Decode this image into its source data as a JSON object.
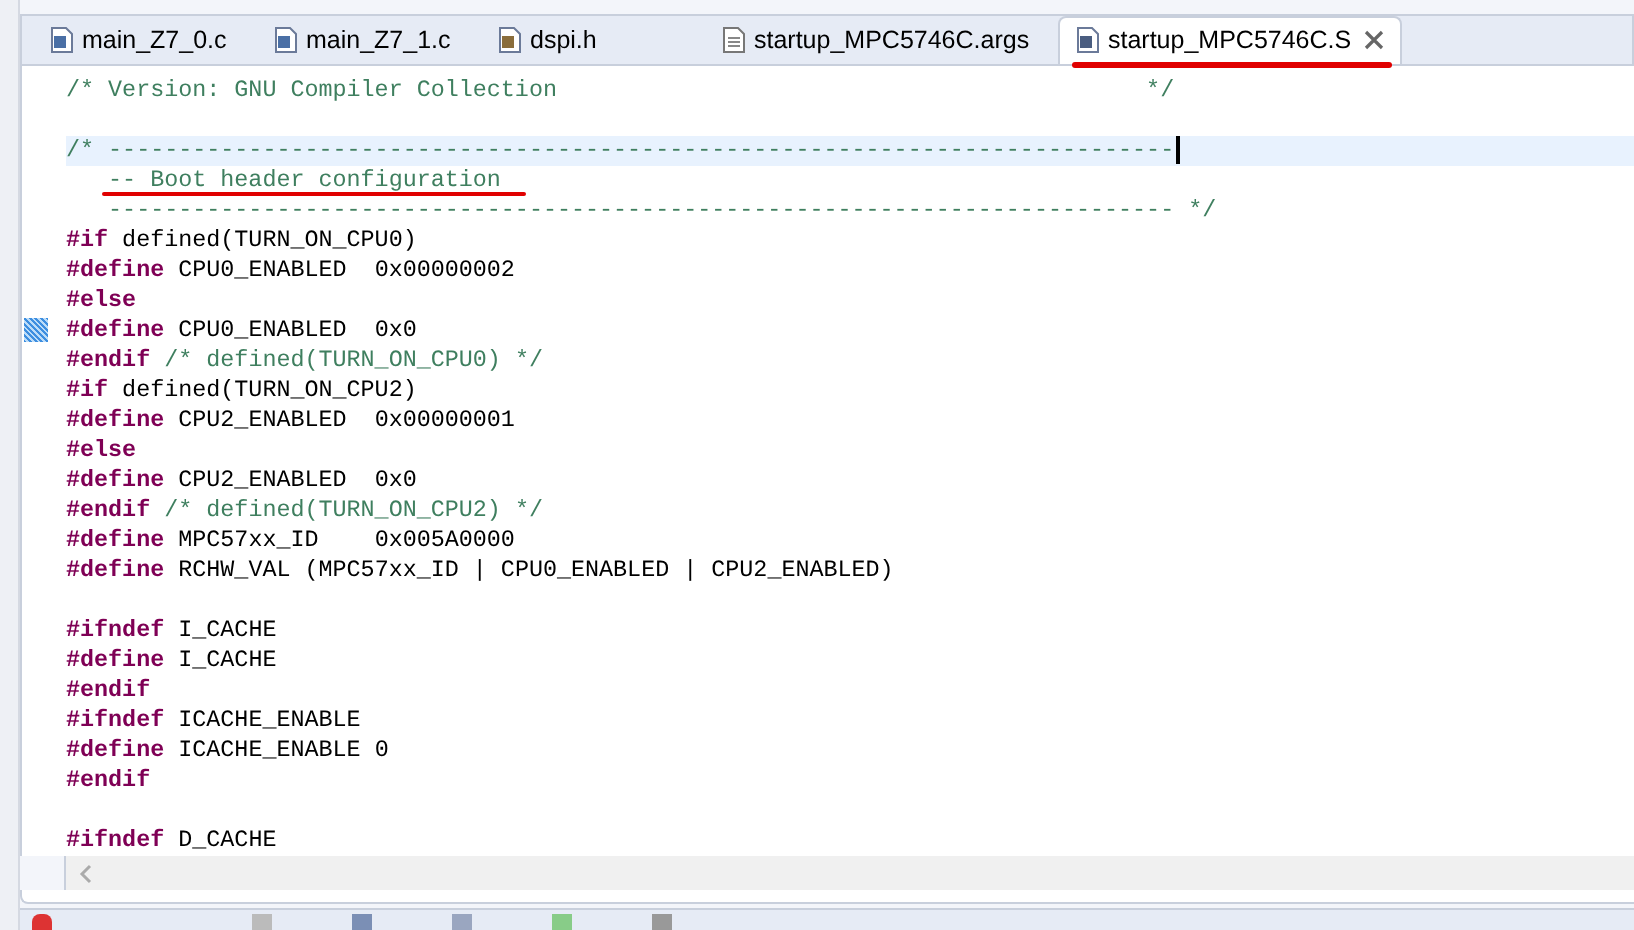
{
  "tabs": [
    {
      "label": "main_Z7_0.c",
      "kind": "c",
      "selected": false
    },
    {
      "label": "main_Z7_1.c",
      "kind": "c",
      "selected": false
    },
    {
      "label": "dspi.h",
      "kind": "h",
      "selected": false
    },
    {
      "label": "startup_MPC5746C.args",
      "kind": "text",
      "selected": false
    },
    {
      "label": "startup_MPC5746C.S",
      "kind": "asm",
      "selected": true
    }
  ],
  "lines": [
    {
      "kind": "code",
      "current": false,
      "bookmark": false,
      "tokens": [
        {
          "kind": "comment",
          "text": "/* Version: GNU Compiler Collection                                          */"
        }
      ]
    },
    {
      "kind": "blank",
      "current": false,
      "bookmark": false
    },
    {
      "kind": "code",
      "current": true,
      "bookmark": false,
      "tokens": [
        {
          "kind": "comment",
          "text": "/* ----------------------------------------------------------------------------"
        }
      ]
    },
    {
      "kind": "code",
      "current": false,
      "bookmark": false,
      "tokens": [
        {
          "kind": "comment",
          "text": "   -- Boot header configuration"
        }
      ]
    },
    {
      "kind": "code",
      "current": false,
      "bookmark": false,
      "tokens": [
        {
          "kind": "comment",
          "text": "   ---------------------------------------------------------------------------- */"
        }
      ]
    },
    {
      "kind": "code",
      "current": false,
      "bookmark": false,
      "tokens": [
        {
          "kind": "directive",
          "text": "#if"
        },
        {
          "kind": "plain",
          "text": " defined(TURN_ON_CPU0)"
        }
      ]
    },
    {
      "kind": "code",
      "current": false,
      "bookmark": false,
      "tokens": [
        {
          "kind": "directive",
          "text": "#define"
        },
        {
          "kind": "plain",
          "text": " CPU0_ENABLED  0x00000002"
        }
      ]
    },
    {
      "kind": "code",
      "current": false,
      "bookmark": false,
      "tokens": [
        {
          "kind": "directive",
          "text": "#else"
        }
      ]
    },
    {
      "kind": "code",
      "current": false,
      "bookmark": true,
      "tokens": [
        {
          "kind": "directive",
          "text": "#define"
        },
        {
          "kind": "plain",
          "text": " CPU0_ENABLED  0x0"
        }
      ]
    },
    {
      "kind": "code",
      "current": false,
      "bookmark": false,
      "tokens": [
        {
          "kind": "directive",
          "text": "#endif"
        },
        {
          "kind": "comment",
          "text": " /* defined(TURN_ON_CPU0) */"
        }
      ]
    },
    {
      "kind": "code",
      "current": false,
      "bookmark": false,
      "tokens": [
        {
          "kind": "directive",
          "text": "#if"
        },
        {
          "kind": "plain",
          "text": " defined(TURN_ON_CPU2)"
        }
      ]
    },
    {
      "kind": "code",
      "current": false,
      "bookmark": false,
      "tokens": [
        {
          "kind": "directive",
          "text": "#define"
        },
        {
          "kind": "plain",
          "text": " CPU2_ENABLED  0x00000001"
        }
      ]
    },
    {
      "kind": "code",
      "current": false,
      "bookmark": false,
      "tokens": [
        {
          "kind": "directive",
          "text": "#else"
        }
      ]
    },
    {
      "kind": "code",
      "current": false,
      "bookmark": false,
      "tokens": [
        {
          "kind": "directive",
          "text": "#define"
        },
        {
          "kind": "plain",
          "text": " CPU2_ENABLED  0x0"
        }
      ]
    },
    {
      "kind": "code",
      "current": false,
      "bookmark": false,
      "tokens": [
        {
          "kind": "directive",
          "text": "#endif"
        },
        {
          "kind": "comment",
          "text": " /* defined(TURN_ON_CPU2) */"
        }
      ]
    },
    {
      "kind": "code",
      "current": false,
      "bookmark": false,
      "tokens": [
        {
          "kind": "directive",
          "text": "#define"
        },
        {
          "kind": "plain",
          "text": " MPC57xx_ID    0x005A0000"
        }
      ]
    },
    {
      "kind": "code",
      "current": false,
      "bookmark": false,
      "tokens": [
        {
          "kind": "directive",
          "text": "#define"
        },
        {
          "kind": "plain",
          "text": " RCHW_VAL (MPC57xx_ID | CPU0_ENABLED | CPU2_ENABLED)"
        }
      ]
    },
    {
      "kind": "blank",
      "current": false,
      "bookmark": false
    },
    {
      "kind": "code",
      "current": false,
      "bookmark": false,
      "tokens": [
        {
          "kind": "directive",
          "text": "#ifndef"
        },
        {
          "kind": "plain",
          "text": " I_CACHE"
        }
      ]
    },
    {
      "kind": "code",
      "current": false,
      "bookmark": false,
      "tokens": [
        {
          "kind": "directive",
          "text": "#define"
        },
        {
          "kind": "plain",
          "text": " I_CACHE"
        }
      ]
    },
    {
      "kind": "code",
      "current": false,
      "bookmark": false,
      "tokens": [
        {
          "kind": "directive",
          "text": "#endif"
        }
      ]
    },
    {
      "kind": "code",
      "current": false,
      "bookmark": false,
      "tokens": [
        {
          "kind": "directive",
          "text": "#ifndef"
        },
        {
          "kind": "plain",
          "text": " ICACHE_ENABLE"
        }
      ]
    },
    {
      "kind": "code",
      "current": false,
      "bookmark": false,
      "tokens": [
        {
          "kind": "directive",
          "text": "#define"
        },
        {
          "kind": "plain",
          "text": " ICACHE_ENABLE 0"
        }
      ]
    },
    {
      "kind": "code",
      "current": false,
      "bookmark": false,
      "tokens": [
        {
          "kind": "directive",
          "text": "#endif"
        }
      ]
    },
    {
      "kind": "blank",
      "current": false,
      "bookmark": false
    },
    {
      "kind": "code",
      "current": false,
      "bookmark": false,
      "tokens": [
        {
          "kind": "directive",
          "text": "#ifndef"
        },
        {
          "kind": "plain",
          "text": " D_CACHE"
        }
      ]
    }
  ]
}
